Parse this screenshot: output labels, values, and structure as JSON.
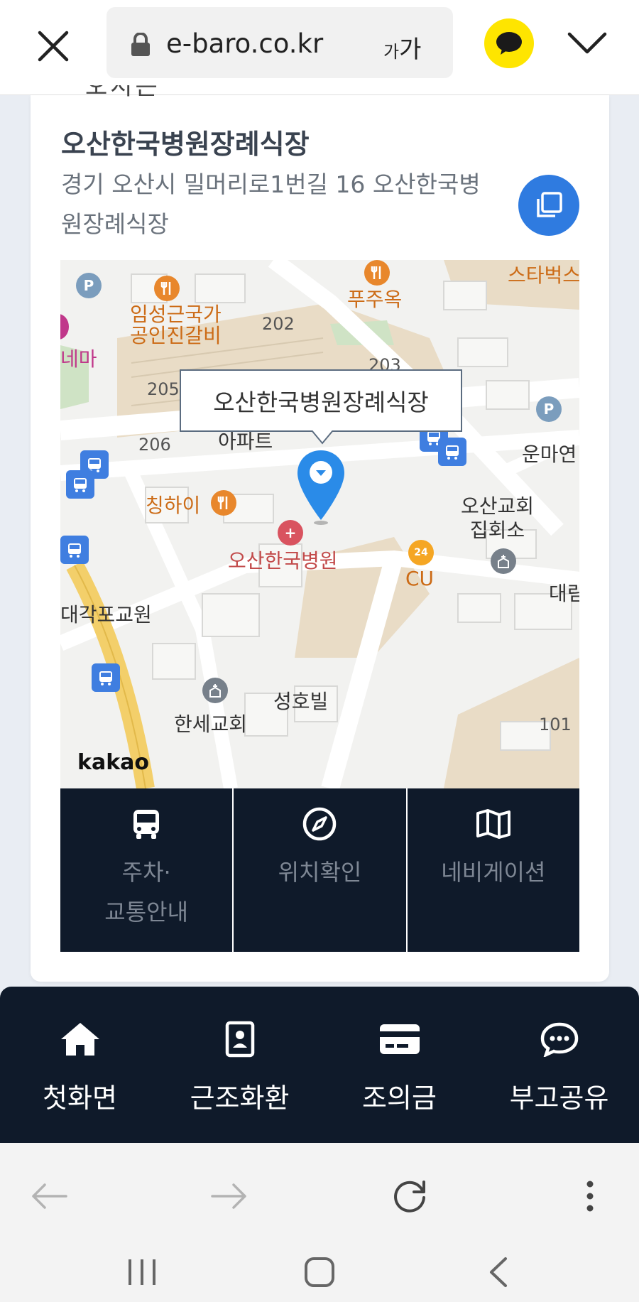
{
  "browser": {
    "url": "e-baro.co.kr",
    "text_size_small": "가",
    "text_size_large": "가"
  },
  "venue": {
    "cut_heading": "오시는 길",
    "name": "오산한국병원장례식장",
    "address": "경기 오산시 밀머리로1번길 16 오산한국병원장례식장"
  },
  "map": {
    "callout": "오산한국병원장례식장",
    "provider": "kakao",
    "labels": {
      "starbucks": "스타벅스",
      "pujuok": "푸주옥",
      "restaurant": "임성근국가\n공인진갈비",
      "cinema": "네마",
      "b202": "202",
      "b203": "203",
      "b205": "205",
      "b206": "206",
      "apartment": "아파트",
      "unma": "운마연",
      "chinghai": "칭하이",
      "church_hall": "오산교회\n집회소",
      "hospital": "오산한국병원",
      "cu": "CU",
      "daeri": "대림",
      "daegak": "대각포교원",
      "seongho": "성호빌",
      "hanse": "한세교회",
      "b101": "101"
    }
  },
  "actions": [
    {
      "label": "주차·\n교통안내",
      "icon": "bus-icon"
    },
    {
      "label": "위치확인",
      "icon": "compass-icon"
    },
    {
      "label": "네비게이션",
      "icon": "map-icon"
    }
  ],
  "bottom_nav": [
    {
      "label": "첫화면",
      "icon": "home-icon"
    },
    {
      "label": "근조화환",
      "icon": "contact-card-icon"
    },
    {
      "label": "조의금",
      "icon": "credit-card-icon"
    },
    {
      "label": "부고공유",
      "icon": "chat-bubble-icon"
    }
  ],
  "colors": {
    "dark_navy": "#0f1a2a",
    "accent_blue": "#2f7be0",
    "kakao_yellow": "#fee500"
  }
}
